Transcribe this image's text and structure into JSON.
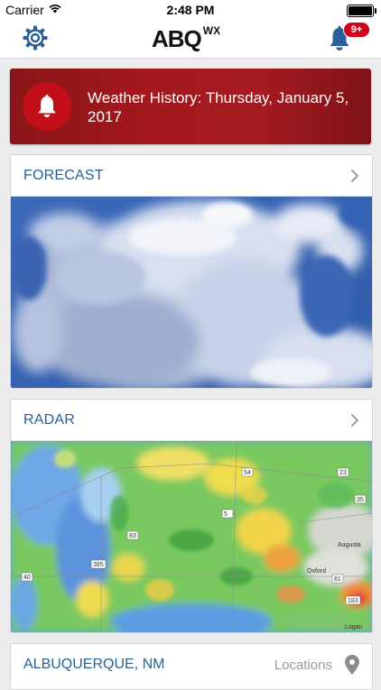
{
  "status": {
    "carrier": "Carrier",
    "time": "2:48 PM"
  },
  "nav": {
    "logo_main": "ABQ",
    "logo_sup": "WX",
    "badge": "9+"
  },
  "alert": {
    "text": "Weather History: Thursday, January 5, 2017",
    "icon": "bell-icon"
  },
  "forecast": {
    "title": "FORECAST"
  },
  "radar": {
    "title": "RADAR"
  },
  "location": {
    "title": "ALBUQUERQUE, NM",
    "locations_label": "Locations"
  },
  "colors": {
    "accent_blue": "#2b5f97",
    "alert_red": "#a4191e",
    "badge_red": "#d0021b"
  },
  "radar_labels": {
    "roads": [
      "385",
      "40",
      "83",
      "54",
      "81",
      "183",
      "35",
      "23",
      "5"
    ],
    "towns": [
      "Oxford",
      "Augusta",
      "Logan"
    ]
  }
}
